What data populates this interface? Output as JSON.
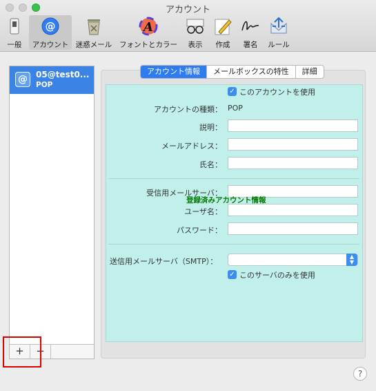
{
  "window": {
    "title": "アカウント"
  },
  "toolbar": {
    "items": [
      {
        "label": "一般",
        "icon": "switch-icon"
      },
      {
        "label": "アカウント",
        "icon": "at-icon"
      },
      {
        "label": "迷惑メール",
        "icon": "trash-icon"
      },
      {
        "label": "フォントとカラー",
        "icon": "font-icon"
      },
      {
        "label": "表示",
        "icon": "glasses-icon"
      },
      {
        "label": "作成",
        "icon": "pencil-icon"
      },
      {
        "label": "署名",
        "icon": "signature-icon"
      },
      {
        "label": "ルール",
        "icon": "rules-icon"
      }
    ],
    "selected_index": 1
  },
  "accounts": [
    {
      "name": "05@test0...",
      "type": "POP",
      "icon_glyph": "@"
    }
  ],
  "sidebar_buttons": {
    "add": "+",
    "remove": "−"
  },
  "tabs": [
    {
      "label": "アカウント情報",
      "active": true
    },
    {
      "label": "メールボックスの特性",
      "active": false
    },
    {
      "label": "詳細",
      "active": false
    }
  ],
  "form": {
    "enable_account": {
      "label": "このアカウントを使用",
      "checked": true
    },
    "account_type": {
      "label": "アカウントの種類：",
      "value": "POP"
    },
    "description": {
      "label": "説明：",
      "value": ""
    },
    "email": {
      "label": "メールアドレス：",
      "value": ""
    },
    "full_name": {
      "label": "氏名：",
      "value": ""
    },
    "incoming_server": {
      "label": "受信用メールサーバ：",
      "value": ""
    },
    "username": {
      "label": "ユーザ名：",
      "value": ""
    },
    "password": {
      "label": "パスワード：",
      "value": ""
    },
    "outgoing_server": {
      "label": "送信用メールサーバ（SMTP）：",
      "value": ""
    },
    "use_only_this_server": {
      "label": "このサーバのみを使用",
      "checked": true
    },
    "overlay_note": "登録済みアカウント情報"
  },
  "help": {
    "label": "?"
  },
  "colors": {
    "accent": "#3b84e6",
    "content_bg": "#c1f0ea",
    "highlight": "#e00000",
    "overlay_text": "#007a00"
  }
}
